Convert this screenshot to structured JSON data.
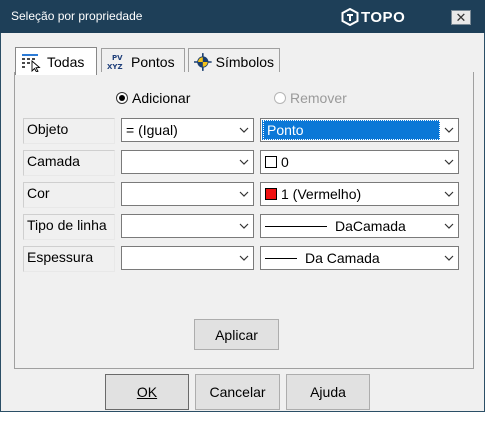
{
  "window": {
    "title": "Seleção por propriedade",
    "brand": "TOPO",
    "close_symbol": "✕"
  },
  "tabs": [
    {
      "label": "Todas",
      "icon": "select-all-icon",
      "active": true
    },
    {
      "label": "Pontos",
      "icon": "points-xyz-icon",
      "active": false
    },
    {
      "label": "Símbolos",
      "icon": "symbol-target-icon",
      "active": false
    }
  ],
  "mode": {
    "add_label": "Adicionar",
    "add_selected": true,
    "remove_label": "Remover",
    "remove_enabled": false
  },
  "rows": [
    {
      "label": "Objeto",
      "operator": "= (Igual)",
      "value": "Ponto",
      "value_kind": "highlight"
    },
    {
      "label": "Camada",
      "operator": "",
      "value": "0",
      "value_kind": "swatch",
      "swatch_color": "#ffffff"
    },
    {
      "label": "Cor",
      "operator": "",
      "value": "1 (Vermelho)",
      "value_kind": "swatch",
      "swatch_color": "#ee1111"
    },
    {
      "label": "Tipo de linha",
      "operator": "",
      "value": "DaCamada",
      "value_kind": "line"
    },
    {
      "label": "Espessura",
      "operator": "",
      "value": "Da Camada",
      "value_kind": "line"
    }
  ],
  "buttons": {
    "apply": "Aplicar",
    "ok": "OK",
    "cancel": "Cancelar",
    "help": "Ajuda"
  },
  "colors": {
    "titlebar": "#1e3f58",
    "selection": "#0b78d7",
    "red": "#ee1111"
  }
}
